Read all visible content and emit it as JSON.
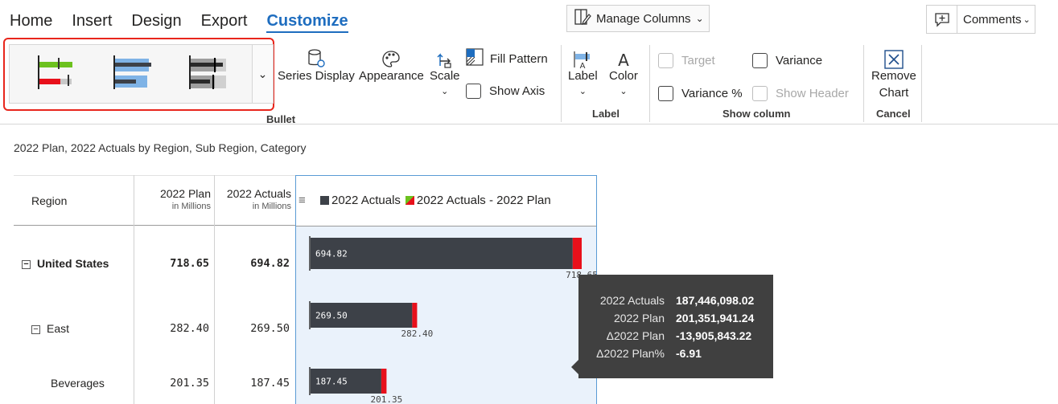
{
  "ribbon": {
    "tabs": [
      {
        "label": "Home"
      },
      {
        "label": "Insert"
      },
      {
        "label": "Design"
      },
      {
        "label": "Export"
      },
      {
        "label": "Customize",
        "active": true
      }
    ],
    "manage_columns": "Manage Columns",
    "comments": "Comments",
    "bullet_group": {
      "label": "Bullet",
      "series_display": "Series Display",
      "appearance": "Appearance",
      "scale": "Scale",
      "fill_pattern": "Fill Pattern",
      "show_axis": "Show Axis"
    },
    "label_group": {
      "label": "Label",
      "label_btn": "Label",
      "color_btn": "Color"
    },
    "show_column_group": {
      "label": "Show column",
      "target": "Target",
      "variance": "Variance",
      "variance_pct": "Variance %",
      "show_header": "Show Header"
    },
    "cancel_group": {
      "label": "Cancel",
      "remove_line1": "Remove",
      "remove_line2": "Chart"
    }
  },
  "subtitle": "2022 Plan, 2022 Actuals by Region, Sub Region, Category",
  "table": {
    "headers": {
      "region": "Region",
      "plan": "2022 Plan",
      "plan_sub": "in Millions",
      "actuals": "2022 Actuals",
      "actuals_sub": "in Millions"
    },
    "rows": [
      {
        "label": "United States",
        "plan": "718.65",
        "actuals": "694.82"
      },
      {
        "label": "East",
        "plan": "282.40",
        "actuals": "269.50"
      },
      {
        "label": "Beverages",
        "plan": "201.35",
        "actuals": "187.45"
      }
    ]
  },
  "legend": {
    "actuals": "2022 Actuals",
    "variance": "2022 Actuals - 2022 Plan"
  },
  "chart_data": {
    "type": "bar",
    "categories": [
      "United States",
      "East",
      "Beverages"
    ],
    "series": [
      {
        "name": "2022 Actuals",
        "values": [
          694.82,
          269.5,
          187.45
        ]
      },
      {
        "name": "2022 Plan",
        "values": [
          718.65,
          282.4,
          201.35
        ]
      }
    ],
    "value_labels": {
      "actuals": [
        "694.82",
        "269.50",
        "187.45"
      ],
      "plan": [
        "718.65",
        "282.40",
        "201.35"
      ]
    },
    "colors": {
      "actuals": "#3d4148",
      "variance_negative": "#e8101b",
      "variance_positive": "#6cc11e"
    }
  },
  "tooltip": {
    "rows": [
      {
        "key": "2022 Actuals",
        "value": "187,446,098.02"
      },
      {
        "key": "2022 Plan",
        "value": "201,351,941.24"
      },
      {
        "key": "Δ2022 Plan",
        "value": "-13,905,843.22"
      },
      {
        "key": "Δ2022 Plan%",
        "value": "-6.91"
      }
    ]
  }
}
